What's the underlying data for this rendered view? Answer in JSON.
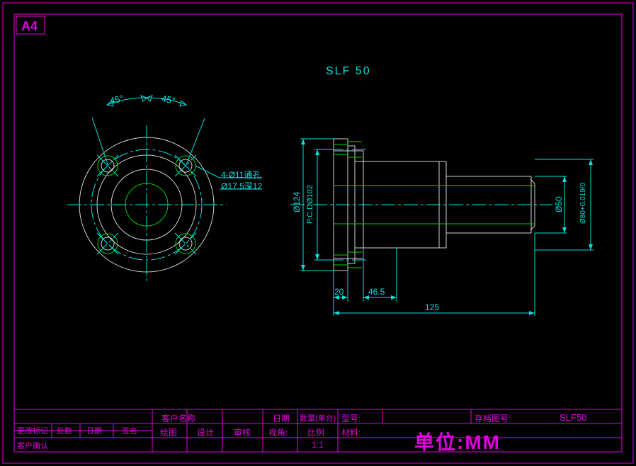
{
  "sheet": {
    "format": "A4"
  },
  "title": "SLF 50",
  "front_view": {
    "angle_left": "45°",
    "angle_right": "45°",
    "hole_note1": "4-Ø11通孔",
    "hole_note2": "Ø17.5深12"
  },
  "side_view": {
    "dim_outer": "Ø124",
    "dim_pcd": "P.C.DØ102",
    "dim_50": "Ø50",
    "dim_tol": "Ø80+0.019/0",
    "dim_20": "20",
    "dim_46_5": "46.5",
    "dim_125": "125"
  },
  "titleblock": {
    "customer_name_label": "客户名称",
    "date_label": "日期",
    "qty_label": "数量(单台)",
    "model_label": "型号:",
    "stored_no_label": "存档图号:",
    "part_no": "SLF50",
    "drawn_label": "绘图",
    "design_label": "设计",
    "check_label": "审核",
    "proj_label": "视角:",
    "scale_label": "比例",
    "scale_value": "1:1",
    "material_label": "材料:",
    "unit_label": "单位:MM",
    "rev_label": "更改标记",
    "proc_label": "处数",
    "date2_label": "日期",
    "sign_label": "签名",
    "confirm_label": "客户确认"
  }
}
